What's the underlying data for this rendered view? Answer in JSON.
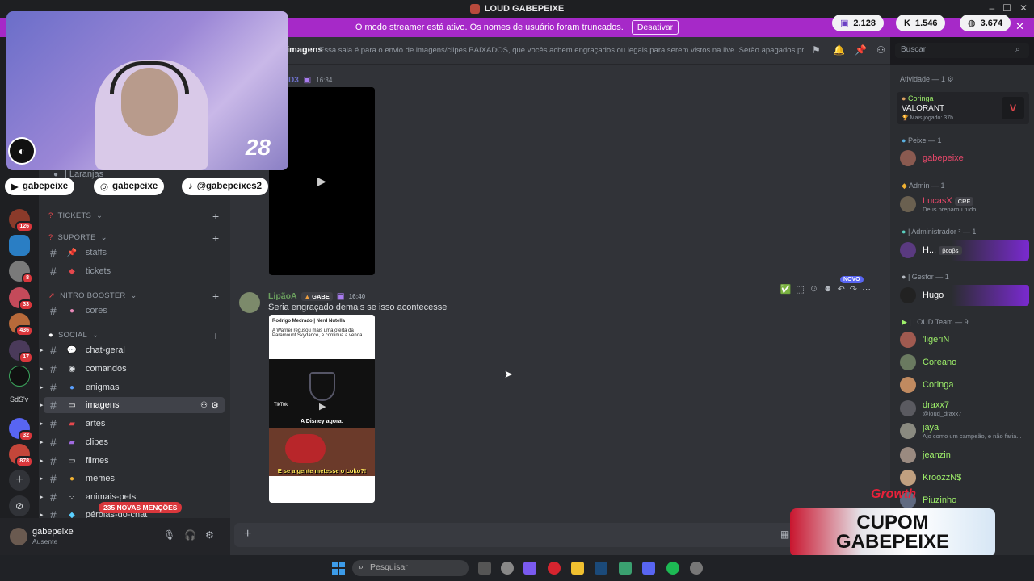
{
  "titlebar": {
    "title": "LOUD GABEPEIXE"
  },
  "banner": {
    "text": "O modo streamer está ativo. Os nomes de usuário foram truncados.",
    "button": "Desativar"
  },
  "pills": [
    {
      "icon": "twitch-icon",
      "value": "2.128"
    },
    {
      "icon": "kick-icon",
      "value": "1.546"
    },
    {
      "icon": "globe-icon",
      "value": "3.674"
    }
  ],
  "header": {
    "channel": "imagens",
    "topic": "Essa sala é para o envio de imagens/clipes BAIXADOS, que vocês achem engraçados ou legais para serem vistos na live. Serão apagados prints de ou...",
    "search_placeholder": "Buscar"
  },
  "webcam": {
    "overlay_number": "28"
  },
  "socials": [
    {
      "icon": "youtube-icon",
      "handle": "gabepeixe"
    },
    {
      "icon": "instagram-icon",
      "handle": "gabepeixe"
    },
    {
      "icon": "tiktok-icon",
      "handle": "@gabepeixes2"
    }
  ],
  "servers": [
    {
      "badge": "126"
    },
    {
      "badge": ""
    },
    {
      "badge": "8"
    },
    {
      "badge": "33"
    },
    {
      "badge": "436"
    },
    {
      "badge": "17"
    },
    {
      "badge": ""
    },
    {
      "label": "SdS'v"
    },
    {
      "badge": "32"
    },
    {
      "badge": "878"
    }
  ],
  "partial": {
    "laranjas": "| Laranjas",
    "top_badge": "70"
  },
  "categories": {
    "tickets": "TICKETS",
    "suporte": "SUPORTE",
    "nitro": "NITRO BOOSTER",
    "social": "SOCIAL"
  },
  "channels": {
    "staffs": "| staffs",
    "tickets": "| tickets",
    "cores": "| cores",
    "chat_geral": "| chat-geral",
    "comandos": "| comandos",
    "enigmas": "| enigmas",
    "imagens": "| imagens",
    "artes": "| artes",
    "clipes": "| clipes",
    "filmes": "| filmes",
    "memes": "| memes",
    "animais": "| animais-pets",
    "perolas": "| pérolas-do-chat"
  },
  "mentions": "235 NOVAS MENÇÕES",
  "user": {
    "name": "gabepeixe",
    "status": "Ausente"
  },
  "messages": {
    "first": {
      "author_partial": "D3",
      "time": "16:34"
    },
    "second": {
      "author": "LipãoA",
      "tag": "GABE",
      "time": "16:40",
      "text": "Seria engraçado demais se isso acontecesse",
      "new_label": "NOVO",
      "image": {
        "tweet_author": "Rodrigo Medrado | Nerd Nutella",
        "tweet_text": "A Warner recusou mais uma oferta da Paramount Skydance, e continua a venda.",
        "disney": "A Disney agora:",
        "caption": "E se a gente metesse o Loko?!",
        "tiktok": "TikTok"
      }
    }
  },
  "members": {
    "activity_header": "Atividade — 1",
    "activity": {
      "user": "Coringa",
      "game": "VALORANT",
      "detail": "Mais jogado: 37h"
    },
    "groups": [
      {
        "title": "Peixe — 1",
        "members": [
          {
            "name": "gabepeixe",
            "color": "#e8486a",
            "status": ""
          }
        ]
      },
      {
        "title": "Admin — 1",
        "members": [
          {
            "name": "LucasX",
            "color": "#e8486a",
            "status": "Deus preparou tudo.",
            "badge": "CRF"
          }
        ]
      },
      {
        "title": "| Administrador ² — 1",
        "members": [
          {
            "name": "H...",
            "color": "#ffffff",
            "status": "",
            "badge": "βcoβs"
          }
        ]
      },
      {
        "title": "| Gestor — 1",
        "members": [
          {
            "name": "Hugo",
            "color": "#ffffff",
            "status": ""
          }
        ]
      },
      {
        "title": "| LOUD Team — 9",
        "members": [
          {
            "name": "'ligeriN",
            "color": "#9ef06a",
            "status": ""
          },
          {
            "name": "Coreano",
            "color": "#9ef06a",
            "status": ""
          },
          {
            "name": "Coringa",
            "color": "#9ef06a",
            "status": ""
          },
          {
            "name": "draxx7",
            "color": "#9ef06a",
            "status": "@loud_draxx7"
          },
          {
            "name": "jaya",
            "color": "#9ef06a",
            "status": "Ajo como um campeão, e não faria..."
          },
          {
            "name": "jeanzin",
            "color": "#9ef06a",
            "status": ""
          },
          {
            "name": "KroozzN$",
            "color": "#9ef06a",
            "status": ""
          },
          {
            "name": "Piuzinho",
            "color": "#9ef06a",
            "status": ""
          }
        ]
      }
    ]
  },
  "overlay": {
    "brand": "Growth",
    "cupom_line1": "CUPOM",
    "cupom_line2": "GABEPEIXE"
  },
  "taskbar": {
    "search_placeholder": "Pesquisar"
  }
}
